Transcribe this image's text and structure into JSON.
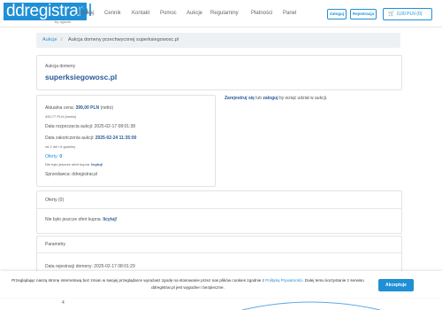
{
  "header": {
    "logo_text": "ddregistrar",
    "logo_tld": ".pl",
    "logo_tagline": "by ogicom",
    "nav": [
      "Szukaj",
      "Cennik",
      "Kontakt",
      "Pomoc",
      "Aukcje",
      "Regulaminy",
      "Płatności",
      "Panel"
    ],
    "login_label": "Zaloguj",
    "register_label": "Rejestracja",
    "cart_label": "0,00 PLN (0)",
    "cart_icon": "cart-icon"
  },
  "breadcrumb": {
    "root": "Aukcje",
    "separator": "/",
    "current": "Aukcja domeny przechwyconej superksiegowosc.pl"
  },
  "domain_card": {
    "label": "Aukcja domeny",
    "domain": "superksiegowosc.pl"
  },
  "details": {
    "price_label": "Aktualna cena:",
    "price_value": "399,00 PLN",
    "price_net": "(netto)",
    "price_gross": "490,77 PLN (brutto)",
    "start_label": "Data rozpoczęcia aukcji:",
    "start_value": "2025-02-17 08:01:38",
    "end_label": "Data zakończenia aukcji:",
    "end_value": "2025-02-24 11:35:00",
    "remaining": "za 2 dni i 6 godziny",
    "offers_label": "Oferty:",
    "offers_value": "0",
    "no_offers_text": "Nie było jeszcze ofert kupna.",
    "bid_link": "licytuj!",
    "seller_label": "Sprzedawca:",
    "seller_value": "ddregistrar.pl"
  },
  "join": {
    "register_link": "Zarejestruj się",
    "or": "lub",
    "login_link": "zaloguj",
    "rest": "by wziąć udział w aukcji."
  },
  "offers_card": {
    "title": "Oferty (0)",
    "text": "Nie było jeszcze ofert kupna.",
    "bid_link": "licytuj!"
  },
  "params_card": {
    "title": "Parametry",
    "reg_date": "Data rejestracji domeny: 2025-02-17 08:01:29"
  },
  "cookie": {
    "text_before": "Przeglądając naszą stronę internetową bez zmian w swojej przeglądarce wyrażasz zgodę na stosowanie przez nas plików cookies zgodnie z",
    "policy_link": "Polityką Prywatności",
    "text_after": ". Dalej temu korzystanie z serwisu ddregistrar.pl jest wygodne i bezpieczne.",
    "accept_label": "Akceptuje"
  },
  "footer_fragment": "4",
  "colors": {
    "brand": "#1f8fd6",
    "heading": "#2a5a9a"
  }
}
